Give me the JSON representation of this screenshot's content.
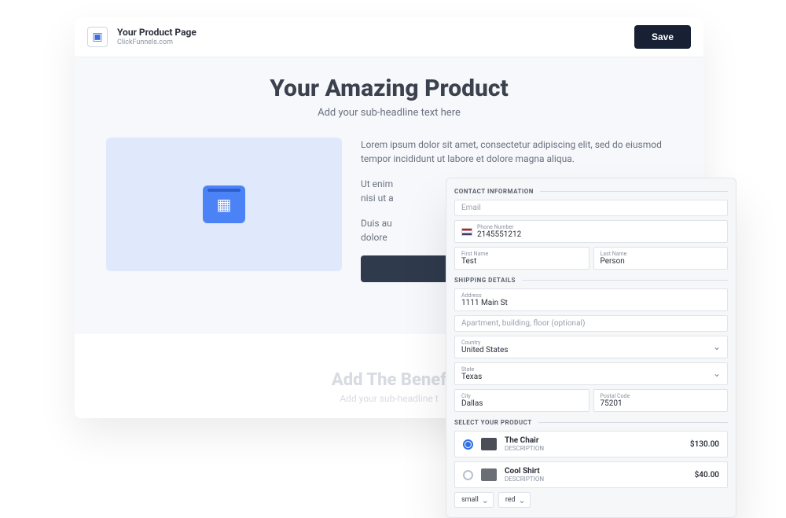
{
  "header": {
    "title": "Your Product Page",
    "subtitle": "ClickFunnels.com",
    "save_label": "Save"
  },
  "hero": {
    "title": "Your Amazing Product",
    "subtitle": "Add your sub-headline text here",
    "para1": "Lorem ipsum dolor sit amet, consectetur adipiscing elit, sed do eiusmod tempor incididunt ut labore et dolore magna aliqua.",
    "para2": "Ut enim",
    "para2b": "nisi ut a",
    "para3": "Duis au",
    "para3b": "dolore"
  },
  "benefit": {
    "title": "Add The Benef",
    "subtitle": "Add your sub-headline t"
  },
  "checkout": {
    "sections": {
      "contact": "CONTACT INFORMATION",
      "shipping": "SHIPPING DETAILS",
      "product": "SELECT YOUR PRODUCT"
    },
    "email_placeholder": "Email",
    "phone_label": "Phone Number",
    "phone_value": "2145551212",
    "first_name_label": "First Name",
    "first_name_value": "Test",
    "last_name_label": "Last Name",
    "last_name_value": "Person",
    "address_label": "Address",
    "address_value": "1111 Main St",
    "address2_placeholder": "Apartment, building, floor (optional)",
    "country_label": "Country",
    "country_value": "United States",
    "state_label": "State",
    "state_value": "Texas",
    "city_label": "City",
    "city_value": "Dallas",
    "postal_label": "Postal Code",
    "postal_value": "75201",
    "products": [
      {
        "name": "The Chair",
        "desc": "DESCRIPTION",
        "price": "$130.00",
        "selected": true
      },
      {
        "name": "Cool Shirt",
        "desc": "DESCRIPTION",
        "price": "$40.00",
        "selected": false
      }
    ],
    "variants": {
      "size": "small",
      "color": "red"
    }
  }
}
